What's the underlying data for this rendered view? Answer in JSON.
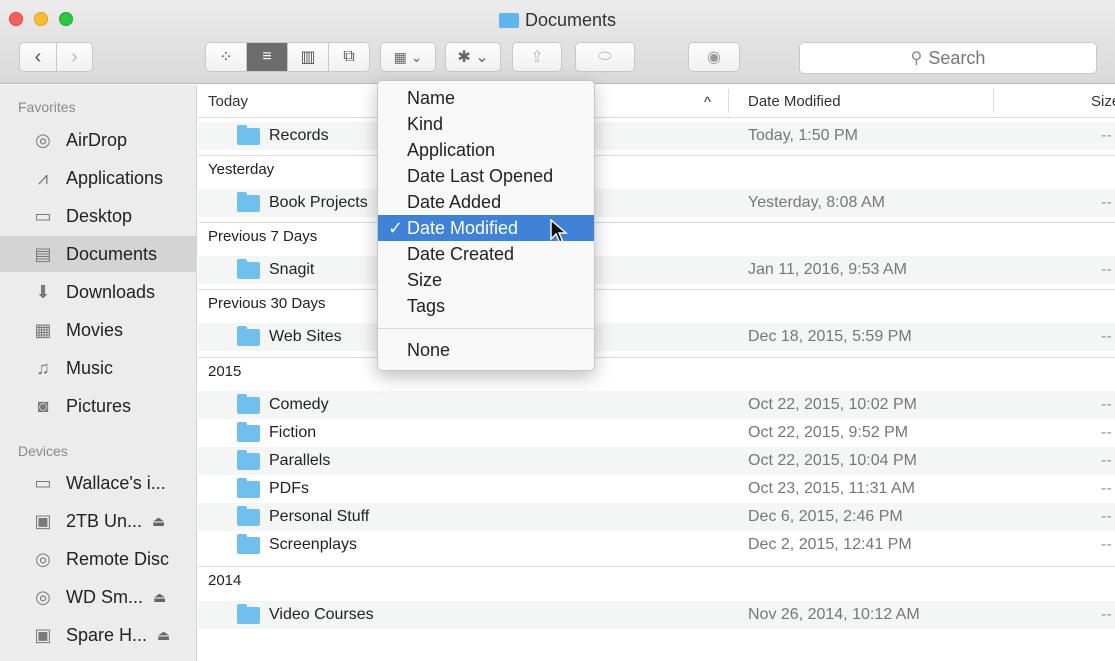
{
  "window": {
    "title": "Documents",
    "colors": {
      "accent": "#3e82d9",
      "folder": "#70c0ef",
      "close": "#fc5f57",
      "minimize": "#fdbc2e",
      "maximize": "#28c840"
    }
  },
  "toolbar": {
    "back_icon": "‹",
    "forward_icon": "›",
    "view_icons": [
      "⁘",
      "≡",
      "▥",
      "⧉"
    ],
    "arrange_icon": "▦ ⌄",
    "action_icon": "✱ ⌄",
    "share_icon": "⇪",
    "tags_icon": "⬭",
    "quicklook_icon": "◉",
    "search_placeholder": "Search",
    "search_icon": "⚲"
  },
  "sidebar": {
    "favorites_heading": "Favorites",
    "favorites": [
      {
        "label": "AirDrop",
        "icon": "◎"
      },
      {
        "label": "Applications",
        "icon": "⩘"
      },
      {
        "label": "Desktop",
        "icon": "▭"
      },
      {
        "label": "Documents",
        "icon": "▤"
      },
      {
        "label": "Downloads",
        "icon": "⬇"
      },
      {
        "label": "Movies",
        "icon": "▦"
      },
      {
        "label": "Music",
        "icon": "♫"
      },
      {
        "label": "Pictures",
        "icon": "◙"
      }
    ],
    "devices_heading": "Devices",
    "devices": [
      {
        "label": "Wallace's i...",
        "icon": "▭",
        "eject": ""
      },
      {
        "label": "2TB Un...",
        "icon": "▣",
        "eject": "⏏"
      },
      {
        "label": "Remote Disc",
        "icon": "◎",
        "eject": ""
      },
      {
        "label": "WD Sm...",
        "icon": "◎",
        "eject": "⏏"
      },
      {
        "label": "Spare H...",
        "icon": "▣",
        "eject": "⏏"
      }
    ]
  },
  "columns": {
    "name": "Today",
    "sort_arrow": "^",
    "date_modified": "Date Modified",
    "size": "Size"
  },
  "groups": [
    {
      "label": "Today",
      "files": [
        {
          "name": "Records",
          "date": "Today, 1:50 PM",
          "size": "--"
        }
      ]
    },
    {
      "label": "Yesterday",
      "files": [
        {
          "name": "Book Projects",
          "date": "Yesterday, 8:08 AM",
          "size": "--"
        }
      ]
    },
    {
      "label": "Previous 7 Days",
      "files": [
        {
          "name": "Snagit",
          "date": "Jan 11, 2016, 9:53 AM",
          "size": "--"
        }
      ]
    },
    {
      "label": "Previous 30 Days",
      "files": [
        {
          "name": "Web Sites",
          "date": "Dec 18, 2015, 5:59 PM",
          "size": "--"
        }
      ]
    },
    {
      "label": "2015",
      "files": [
        {
          "name": "Comedy",
          "date": "Oct 22, 2015, 10:02 PM",
          "size": "--"
        },
        {
          "name": "Fiction",
          "date": "Oct 22, 2015, 9:52 PM",
          "size": "--"
        },
        {
          "name": "Parallels",
          "date": "Oct 22, 2015, 10:04 PM",
          "size": "--"
        },
        {
          "name": "PDFs",
          "date": "Oct 23, 2015, 11:31 AM",
          "size": "--"
        },
        {
          "name": "Personal Stuff",
          "date": "Dec 6, 2015, 2:46 PM",
          "size": "--"
        },
        {
          "name": "Screenplays",
          "date": "Dec 2, 2015, 12:41 PM",
          "size": "--"
        }
      ]
    },
    {
      "label": "2014",
      "files": [
        {
          "name": "Video Courses",
          "date": "Nov 26, 2014, 10:12 AM",
          "size": "--"
        }
      ]
    }
  ],
  "arrange_menu": {
    "items": [
      "Name",
      "Kind",
      "Application",
      "Date Last Opened",
      "Date Added",
      "Date Modified",
      "Date Created",
      "Size",
      "Tags"
    ],
    "selected": "Date Modified",
    "checkmark": "✓",
    "after_separator": "None"
  }
}
